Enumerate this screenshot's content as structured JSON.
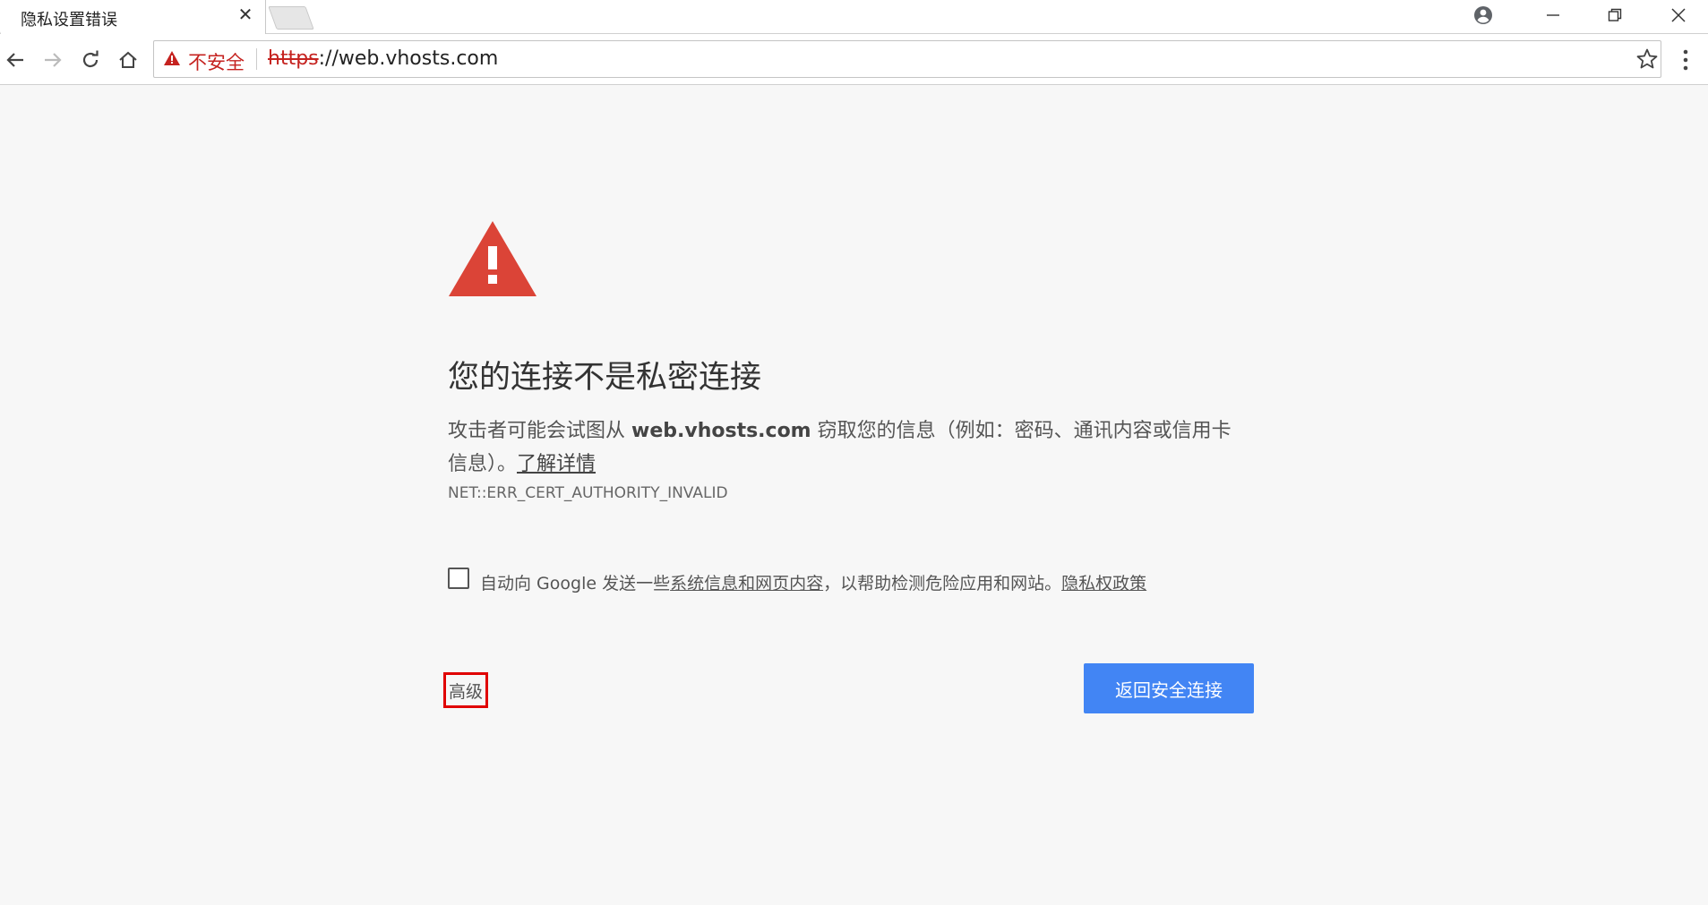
{
  "tab": {
    "title": "隐私设置错误",
    "close": "✕"
  },
  "omnibox": {
    "security_label": "不安全",
    "url_scheme": "https",
    "url_rest": "://web.vhosts.com"
  },
  "colors": {
    "warning_red": "#db4437",
    "primary_blue": "#4285f4",
    "insecure_red": "#c5221f",
    "highlight_red": "#e00000"
  },
  "page": {
    "heading": "您的连接不是私密连接",
    "explain_prefix": "攻击者可能会试图从 ",
    "explain_domain": "web.vhosts.com",
    "explain_suffix": " 窃取您的信息（例如：密码、通讯内容或信用卡信息）。",
    "learn_more": "了解详情",
    "error_code": "NET::ERR_CERT_AUTHORITY_INVALID",
    "report_prefix": "自动向 Google 发送一些",
    "report_link": "系统信息和网页内容",
    "report_middle": "，以帮助检测危险应用和网站。",
    "privacy_link": "隐私权政策",
    "advanced_button": "高级",
    "back_button": "返回安全连接"
  },
  "icons": {
    "profile": "profile-icon",
    "minimize": "minimize-icon",
    "restore": "restore-icon",
    "close": "close-icon",
    "back": "back-arrow-icon",
    "forward": "forward-arrow-icon",
    "reload": "reload-icon",
    "home": "home-icon",
    "warning": "warning-triangle-icon",
    "star": "bookmark-star-icon",
    "menu": "menu-dots-icon"
  }
}
